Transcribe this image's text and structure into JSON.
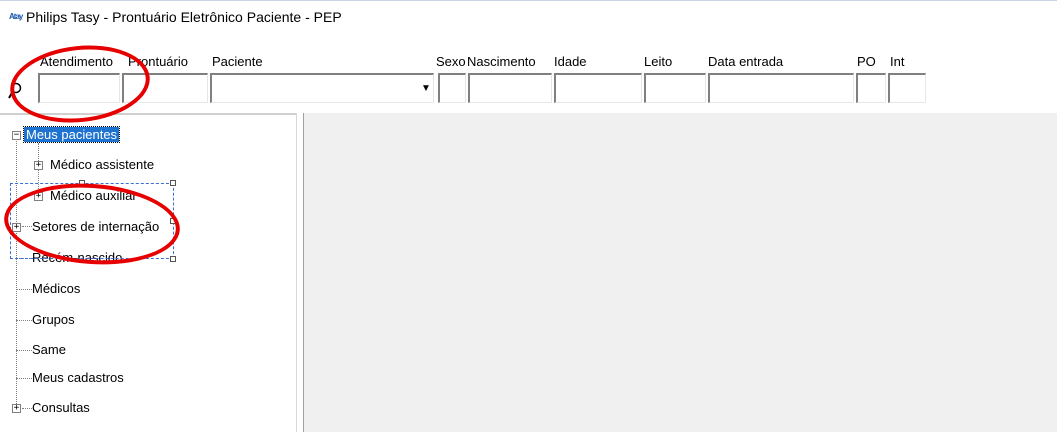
{
  "window": {
    "app_icon_text": "Atay",
    "title": "Philips Tasy - Prontuário Eletrônico Paciente - PEP"
  },
  "filters": {
    "columns": {
      "atendimento": "Atendimento",
      "prontuario": "Prontuário",
      "paciente": "Paciente",
      "sexo": "Sexo",
      "nascimento": "Nascimento",
      "idade": "Idade",
      "leito": "Leito",
      "data_entrada": "Data entrada",
      "po": "PO",
      "int": "Int"
    },
    "combo_arrow": "▼"
  },
  "tree": {
    "items": [
      {
        "label": "Meus pacientes",
        "expander": "−",
        "selected": true
      },
      {
        "label": "Médico assistente",
        "expander": "+"
      },
      {
        "label": "Médico auxiliar",
        "expander": "+"
      },
      {
        "label": "Setores de internação",
        "expander": "+"
      },
      {
        "label": "Recém-nascido"
      },
      {
        "label": "Médicos"
      },
      {
        "label": "Grupos"
      },
      {
        "label": "Same"
      },
      {
        "label": "Meus cadastros"
      },
      {
        "label": "Consultas",
        "expander": "+"
      }
    ]
  },
  "colors": {
    "selection": "#1e73d0",
    "annotation": "#e60000",
    "content_bg": "#f0f0f0"
  }
}
